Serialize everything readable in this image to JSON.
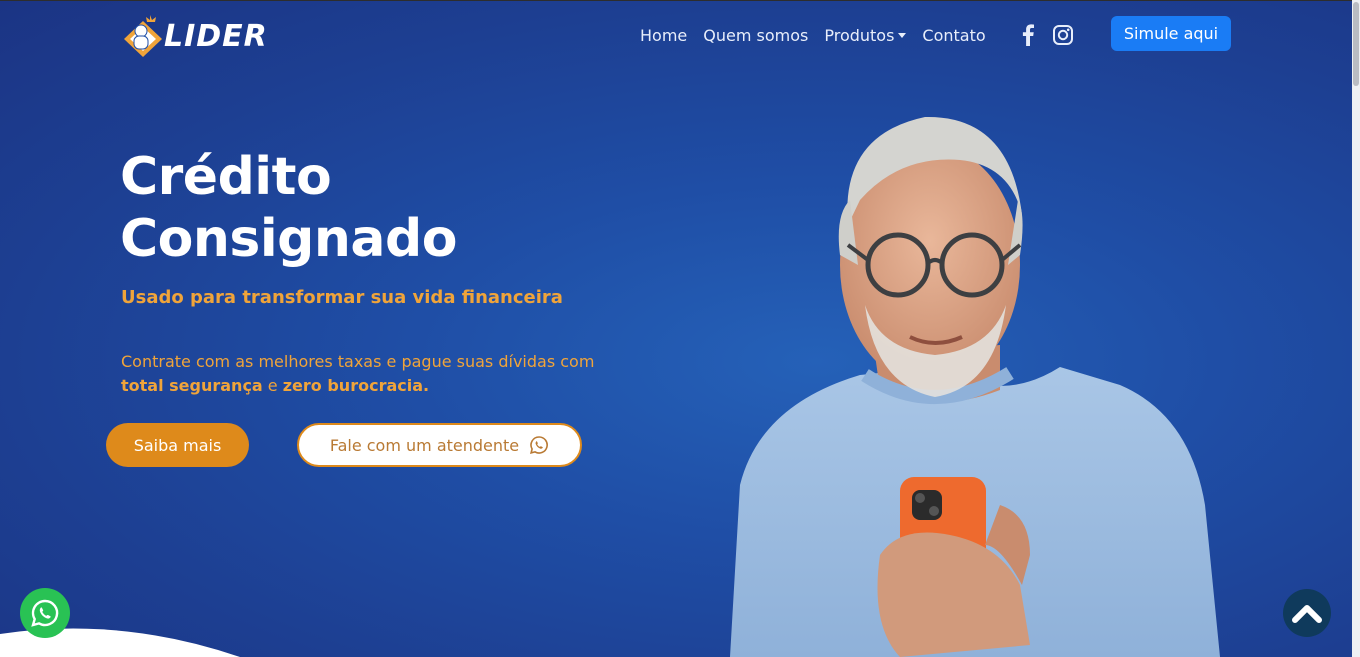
{
  "header": {
    "logo_text": "LIDER",
    "nav": [
      {
        "label": "Home"
      },
      {
        "label": "Quem somos"
      },
      {
        "label": "Produtos",
        "has_dropdown": true
      },
      {
        "label": "Contato"
      }
    ],
    "social_icons": [
      "facebook-icon",
      "instagram-icon"
    ],
    "cta_label": "Simule aqui"
  },
  "hero": {
    "title_line1": "Crédito",
    "title_line2": "Consignado",
    "subtitle": "Usado para transformar sua vida financeira",
    "desc_part1": "Contrate com as melhores taxas e pague suas dívidas com ",
    "desc_bold1": "total segurança",
    "desc_part2": " e ",
    "desc_bold2": "zero burocracia.",
    "btn_primary": "Saiba mais",
    "btn_secondary": "Fale com um atendente"
  },
  "floating": {
    "whatsapp_icon": "whatsapp-icon",
    "scroll_top_icon": "chevron-up-icon"
  },
  "colors": {
    "background": "#1f4ea6",
    "accent_orange": "#de8a1b",
    "text_orange": "#f0a43a",
    "cta_blue": "#1a7cf5",
    "whatsapp_green": "#29c254"
  }
}
